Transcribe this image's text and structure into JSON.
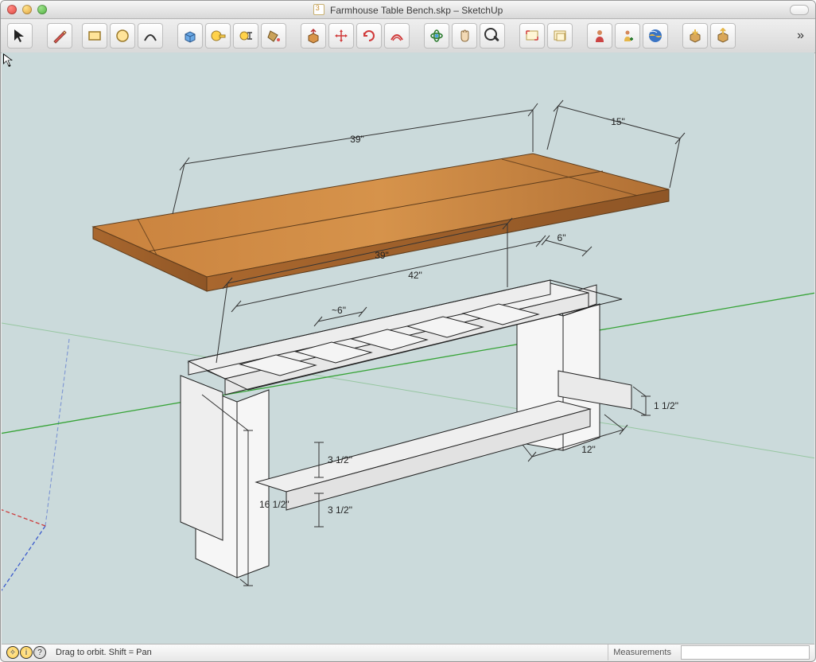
{
  "window": {
    "title_prefix": "Farmhouse Table Bench.skp",
    "title_app": "SketchUp"
  },
  "toolbar": {
    "items": [
      {
        "name": "select-tool",
        "icon": "cursor"
      },
      {
        "name": "line-tool",
        "icon": "line"
      },
      {
        "name": "rectangle-tool",
        "icon": "rect"
      },
      {
        "name": "circle-tool",
        "icon": "circ"
      },
      {
        "name": "arc-tool",
        "icon": "arc"
      },
      {
        "name": "make-component-tool",
        "icon": "component"
      },
      {
        "name": "tape-measure-tool",
        "icon": "tape"
      },
      {
        "name": "dimension-tool",
        "icon": "tape2"
      },
      {
        "name": "paint-bucket-tool",
        "icon": "paint"
      },
      {
        "name": "push-pull-tool",
        "icon": "pushpull"
      },
      {
        "name": "move-tool",
        "icon": "move"
      },
      {
        "name": "rotate-tool",
        "icon": "rotate"
      },
      {
        "name": "offset-tool",
        "icon": "offset"
      },
      {
        "name": "orbit-tool",
        "icon": "orbit"
      },
      {
        "name": "pan-tool",
        "icon": "pan"
      },
      {
        "name": "zoom-tool",
        "icon": "zoom"
      },
      {
        "name": "zoom-extents-tool",
        "icon": "zoomext"
      },
      {
        "name": "previous-view-tool",
        "icon": "prev"
      },
      {
        "name": "add-person-tool",
        "icon": "person"
      },
      {
        "name": "add-location-tool",
        "icon": "location"
      },
      {
        "name": "google-earth-tool",
        "icon": "earth"
      },
      {
        "name": "get-models-tool",
        "icon": "boxdown"
      },
      {
        "name": "share-model-tool",
        "icon": "boxup"
      }
    ],
    "overflow": "»"
  },
  "status": {
    "hint": "Drag to orbit.  Shift = Pan",
    "measurements_label": "Measurements",
    "measurements_value": ""
  },
  "dimensions": {
    "top_length": "39\"",
    "top_width": "15\"",
    "frame_inner": "39\"",
    "frame_outer": "42\"",
    "frame_end": "6\"",
    "frame_spacing": "~6\"",
    "leg_height": "16 1/2\"",
    "apron1": "3 1/2\"",
    "apron2": "3 1/2\"",
    "leg_depth": "12\"",
    "brace": "1 1/2\""
  },
  "colors": {
    "viewport_bg": "#cbdadb",
    "wood_light": "#cf8a45",
    "wood_dark": "#a9672e",
    "axis_red": "#cc3b3b",
    "axis_green": "#36a336",
    "axis_blue": "#3b5bcc",
    "frame_fill": "#f6f6f6",
    "frame_edge": "#222"
  }
}
